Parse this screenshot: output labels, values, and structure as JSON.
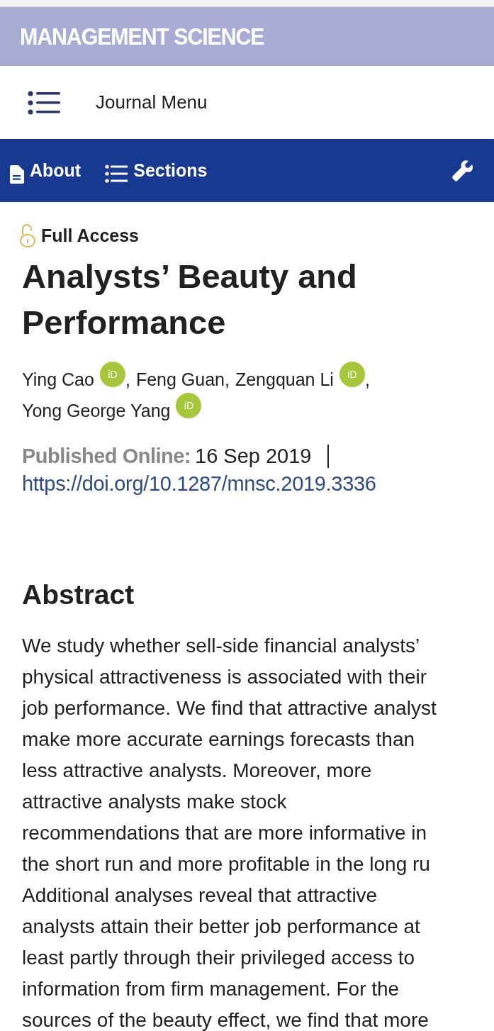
{
  "header": {
    "journal_title": "MANAGEMENT SCIENCE"
  },
  "journal_menu": {
    "label": "Journal Menu"
  },
  "nav_bar": {
    "items": [
      {
        "kind": "document",
        "label": "About"
      },
      {
        "kind": "list",
        "label": "Sections"
      }
    ]
  },
  "article": {
    "access": "Full Access",
    "title": "Analysts’ Beauty and Performance",
    "author_lines": [
      [
        {
          "name": "Ying Cao",
          "orcid": "iD",
          "after": ","
        },
        {
          "name": "Feng Guan,"
        },
        {
          "name": "Zengquan Li",
          "orcid": "iD",
          "after": ","
        }
      ],
      [
        {
          "name": "Yong George Yang",
          "orcid": "iD"
        }
      ]
    ],
    "published_label": "Published Online:",
    "published_date": "16 Sep 2019",
    "doi": "https://doi.org/10.1287/mnsc.2019.3336",
    "abstract_heading": "Abstract",
    "abstract_lines": [
      "We study whether sell-side financial analysts’",
      "physical attractiveness is associated with their",
      "job performance. We find that attractive analyst",
      "make more accurate earnings forecasts than",
      "less attractive analysts. Moreover, more",
      "attractive analysts make stock",
      "recommendations that are more informative in",
      "the short run and more profitable in the long ru",
      "Additional analyses reveal that attractive",
      "analysts attain their better job performance at",
      "least partly through their privileged access to",
      "information from firm management. For the",
      "sources of the beauty effect, we find that more"
    ]
  }
}
